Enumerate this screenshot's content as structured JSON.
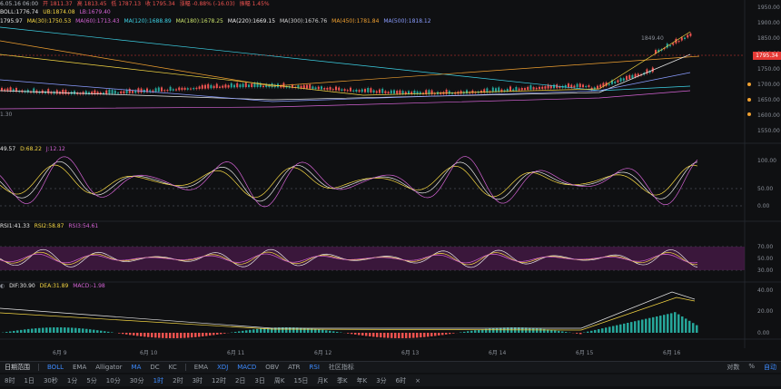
{
  "header": {
    "ohlc_line": {
      "time": "6.05.16 06:00",
      "open": "开 1811.37",
      "high": "高 1813.45",
      "low": "低 1787.13",
      "close": "收 1795.34",
      "change": "涨幅 -0.88% (-16.03)",
      "amplitude": "振幅 1.45%"
    },
    "boll_line": {
      "boll": "BOLL:1776.74",
      "ub": "UB:1874.08",
      "lb": "LB:1679.40"
    },
    "ma_line": {
      "ma_first": "1795.97",
      "ma30": "MA(30):1750.53",
      "ma60": "MA(60):1713.43",
      "ma120": "MA(120):1688.89",
      "ma180": "MA(180):1678.25",
      "ma220": "MA(220):1669.15",
      "ma300": "MA(300):1676.76",
      "ma450": "MA(450):1781.84",
      "ma500": "MA(500):1818.12"
    },
    "kdj_line": {
      "k": "49.57",
      "d": "D:68.22",
      "j": "J:12.12"
    },
    "rsi_line": {
      "rsi1": "RSI1:41.33",
      "rsi2": "RSI2:58.87",
      "rsi3": "RSI3:54.61"
    },
    "macd_line": {
      "dif": "DIF:30.90",
      "dea": "DEA:31.89",
      "macd": "MACD:-1.98"
    }
  },
  "price_axis": {
    "ticks": [
      "1950.00",
      "1900.00",
      "1850.00",
      "1800.00",
      "1750.00",
      "1700.00",
      "1650.00",
      "1600.00",
      "1550.00"
    ],
    "current_price": "1795.34",
    "high_label": "1849.40",
    "low_label": "1.30"
  },
  "kdj_axis": {
    "ticks": [
      "100.00",
      "50.00",
      "0.00"
    ]
  },
  "rsi_axis": {
    "ticks": [
      "70.00",
      "50.00",
      "30.00"
    ]
  },
  "macd_axis": {
    "ticks": [
      "40.00",
      "20.00",
      "0.00"
    ]
  },
  "time_axis": {
    "ticks": [
      "6月 9",
      "6月 10",
      "6月 11",
      "6月 12",
      "6月 13",
      "6月 14",
      "6月 15",
      "6月 16"
    ]
  },
  "toolbar_indicators": {
    "label": "日期范围",
    "items": [
      "BOLL",
      "EMA",
      "Alligator",
      "MA",
      "DC",
      "KC",
      "EMA",
      "XDJ",
      "MACD",
      "OBV",
      "ATR",
      "RSI",
      "社区指标"
    ],
    "active": [
      "BOLL",
      "MA",
      "XDJ",
      "MACD",
      "RSI"
    ],
    "right": [
      "对数",
      "%",
      "自动"
    ]
  },
  "toolbar_intervals": {
    "items": [
      "8时",
      "1日",
      "30秒",
      "1分",
      "5分",
      "10分",
      "30分",
      "1时",
      "2时",
      "3时",
      "12时",
      "2日",
      "3日",
      "周K",
      "15日",
      "月K",
      "季K",
      "年K",
      "3分",
      "6时"
    ],
    "active": "1时",
    "close": "×"
  },
  "colors": {
    "up": "#26a69a",
    "down": "#ef5350",
    "accent": "#3d8bff",
    "rsi_band": "#4a1a4a"
  }
}
